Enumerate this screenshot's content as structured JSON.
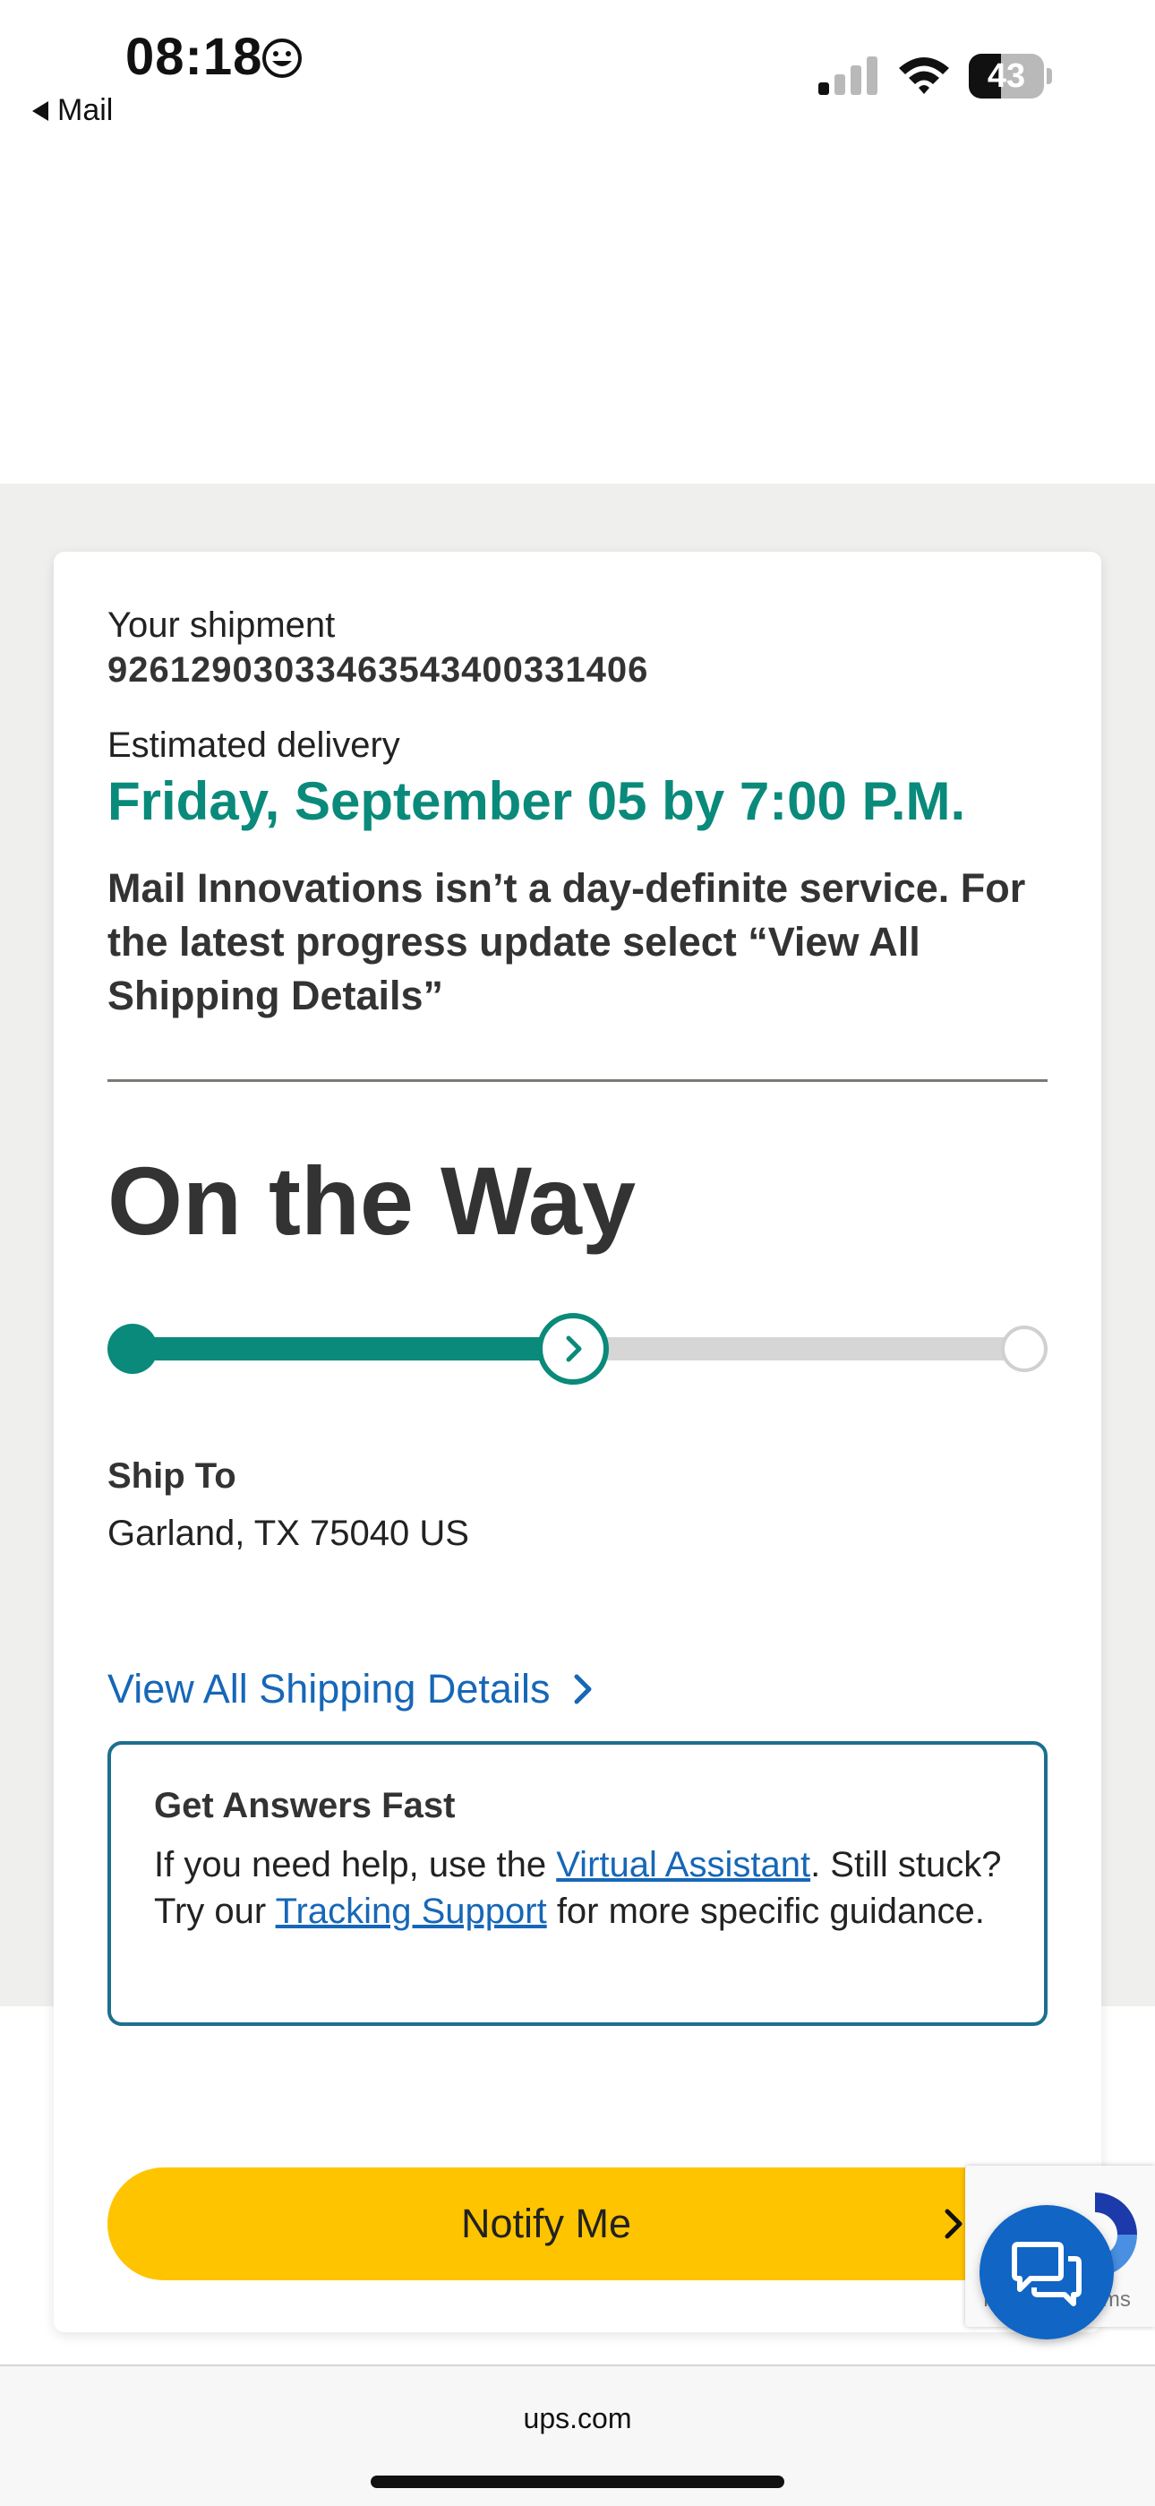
{
  "status_bar": {
    "time": "08:18",
    "back_app": "Mail",
    "battery_level": "43",
    "battery_fraction": 0.43
  },
  "shipment": {
    "label": "Your shipment",
    "tracking_number": "92612903033463543400331406",
    "delivery_label": "Estimated delivery",
    "delivery_date": "Friday, September 05 by 7:00 P.M.",
    "notice": "Mail Innovations isn’t a day-definite service. For the latest progress update select “View All Shipping Details”"
  },
  "status": {
    "heading": "On the Way",
    "progress_fraction": 0.5
  },
  "ship_to": {
    "label": "Ship To",
    "address": "Garland, TX 75040 US"
  },
  "details_link": "View All Shipping Details",
  "help": {
    "title": "Get Answers Fast",
    "text_1": "If you need help, use the ",
    "link_1": "Virtual Assistant",
    "text_2": ". Still stuck? Try our ",
    "link_2": "Tracking Support",
    "text_3": " for more specific guidance."
  },
  "notify_button": "Notify Me",
  "recaptcha_text": "Privacy - Terms",
  "url": "ups.com",
  "colors": {
    "brand_green": "#0a8a7a",
    "link_blue": "#1667b7",
    "notify_yellow": "#ffc400",
    "chat_blue": "#1165c5"
  }
}
